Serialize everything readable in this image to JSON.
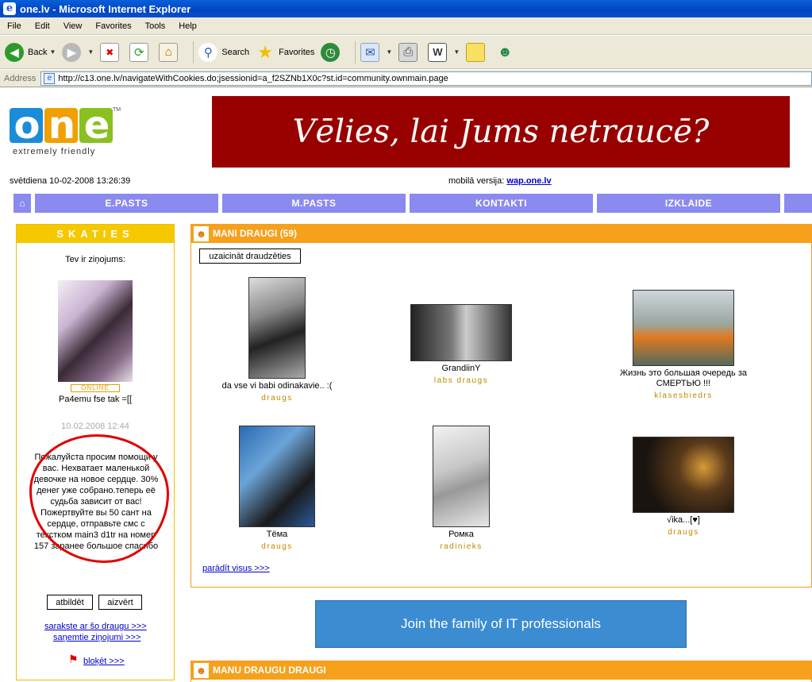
{
  "window": {
    "title": "one.lv - Microsoft Internet Explorer"
  },
  "menu": [
    "File",
    "Edit",
    "View",
    "Favorites",
    "Tools",
    "Help"
  ],
  "toolbar": {
    "back": "Back",
    "search": "Search",
    "favorites": "Favorites"
  },
  "address": {
    "label": "Address",
    "url": "http://c13.one.lv/navigateWithCookies.do;jsessionid=a_f2SZNb1X0c?st.id=community.ownmain.page"
  },
  "logo": {
    "word": "one",
    "tagline": "extremely friendly",
    "tm": "TM"
  },
  "banner": {
    "text": "Vēlies, lai Jums netraucē?"
  },
  "header": {
    "date": "svētdiena 10-02-2008 13:26:39",
    "mobile_label": "mobilā versija:",
    "mobile_link": "wap.one.lv"
  },
  "nav": [
    "E.PASTS",
    "M.PASTS",
    "KONTAKTI",
    "IZKLAIDE"
  ],
  "skaties": {
    "title": "SKATIES",
    "intro": "Tev ir ziņojums:",
    "online": "ONLINE",
    "status": "Pa4emu fse tak =[[",
    "date": "10.02.2008 12:44",
    "message": "Пожалуйста просим помощи у вас. Нехватает маленькой девочке на новое сердце. 30% денег уже собрано.теперь её судьба зависит от вас! Пожертвуйте вы 50 сант на сердце, отправьте смс с текстком main3 d1tr на номер 157 заранее большое спасибо",
    "reply": "atbildēt",
    "close": "aizvērt",
    "link_correspondence": "sarakste ar šo draugu >>>",
    "link_received": "saņemtie ziņojumi >>>",
    "link_block": "bloķēt >>>"
  },
  "draugi": {
    "title": "MANI DRAUGI (59)",
    "invite": "uzaicināt draudzēties",
    "show_all": "parādīt visus >>>",
    "friends": [
      {
        "name": "da vse vi babi odinakavie.. :(",
        "relation": "draugs"
      },
      {
        "name": "GrandiinY",
        "relation": "labs draugs"
      },
      {
        "name": "Жизнь это большая очередь за СМЕРТЬЮ !!!",
        "relation": "klasesbiedrs"
      },
      {
        "name": "Тёма",
        "relation": "draugs"
      },
      {
        "name": "Ромка",
        "relation": "radinieks"
      },
      {
        "name": "√ika...[♥]",
        "relation": "draugs"
      }
    ]
  },
  "ad": {
    "text": "Join the family of IT professionals"
  },
  "draugu_draugi": {
    "title": "MANU DRAUGU DRAUGI"
  },
  "colors": {
    "nav": "#8a8aef",
    "skaties": "#f5c800",
    "draugi": "#f7a01c",
    "banner": "#980000",
    "ad": "#3c8cd2",
    "circle": "#e00000"
  }
}
